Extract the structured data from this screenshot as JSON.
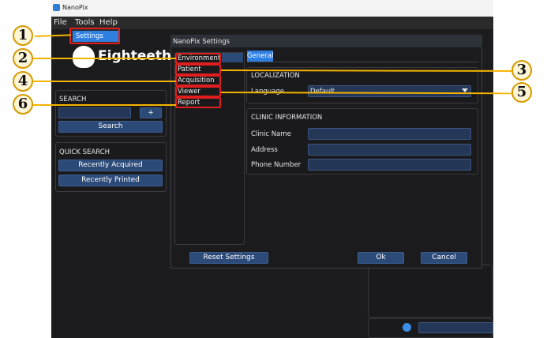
{
  "window": {
    "title": "NanoPix"
  },
  "menubar": {
    "file": "File",
    "tools": "Tools",
    "help": "Help"
  },
  "tools_menu": {
    "settings": "Settings"
  },
  "brand": {
    "logo_text": "Eighteeth"
  },
  "search": {
    "heading": "SEARCH",
    "add_label": "+",
    "search_button": "Search"
  },
  "quick_search": {
    "heading": "QUICK SEARCH",
    "recently_acquired": "Recently Acquired",
    "recently_printed": "Recently Printed"
  },
  "dialog": {
    "title": "NanoPix Settings",
    "nav": [
      "Environment",
      "Patient",
      "Acquisition",
      "Viewer",
      "Report"
    ],
    "tab_general": "General",
    "localization": {
      "heading": "LOCALIZATION",
      "language_label": "Language",
      "language_value": "Default"
    },
    "clinic": {
      "heading": "CLINIC INFORMATION",
      "name_label": "Clinic Name",
      "address_label": "Address",
      "phone_label": "Phone Number"
    },
    "reset_button": "Reset Settings",
    "ok_button": "Ok",
    "cancel_button": "Cancel"
  },
  "callouts": [
    "1",
    "2",
    "3",
    "4",
    "5",
    "6"
  ],
  "colors": {
    "accent": "#2c4a78",
    "highlight": "#e01e1e",
    "callout_line": "#f6b400"
  }
}
